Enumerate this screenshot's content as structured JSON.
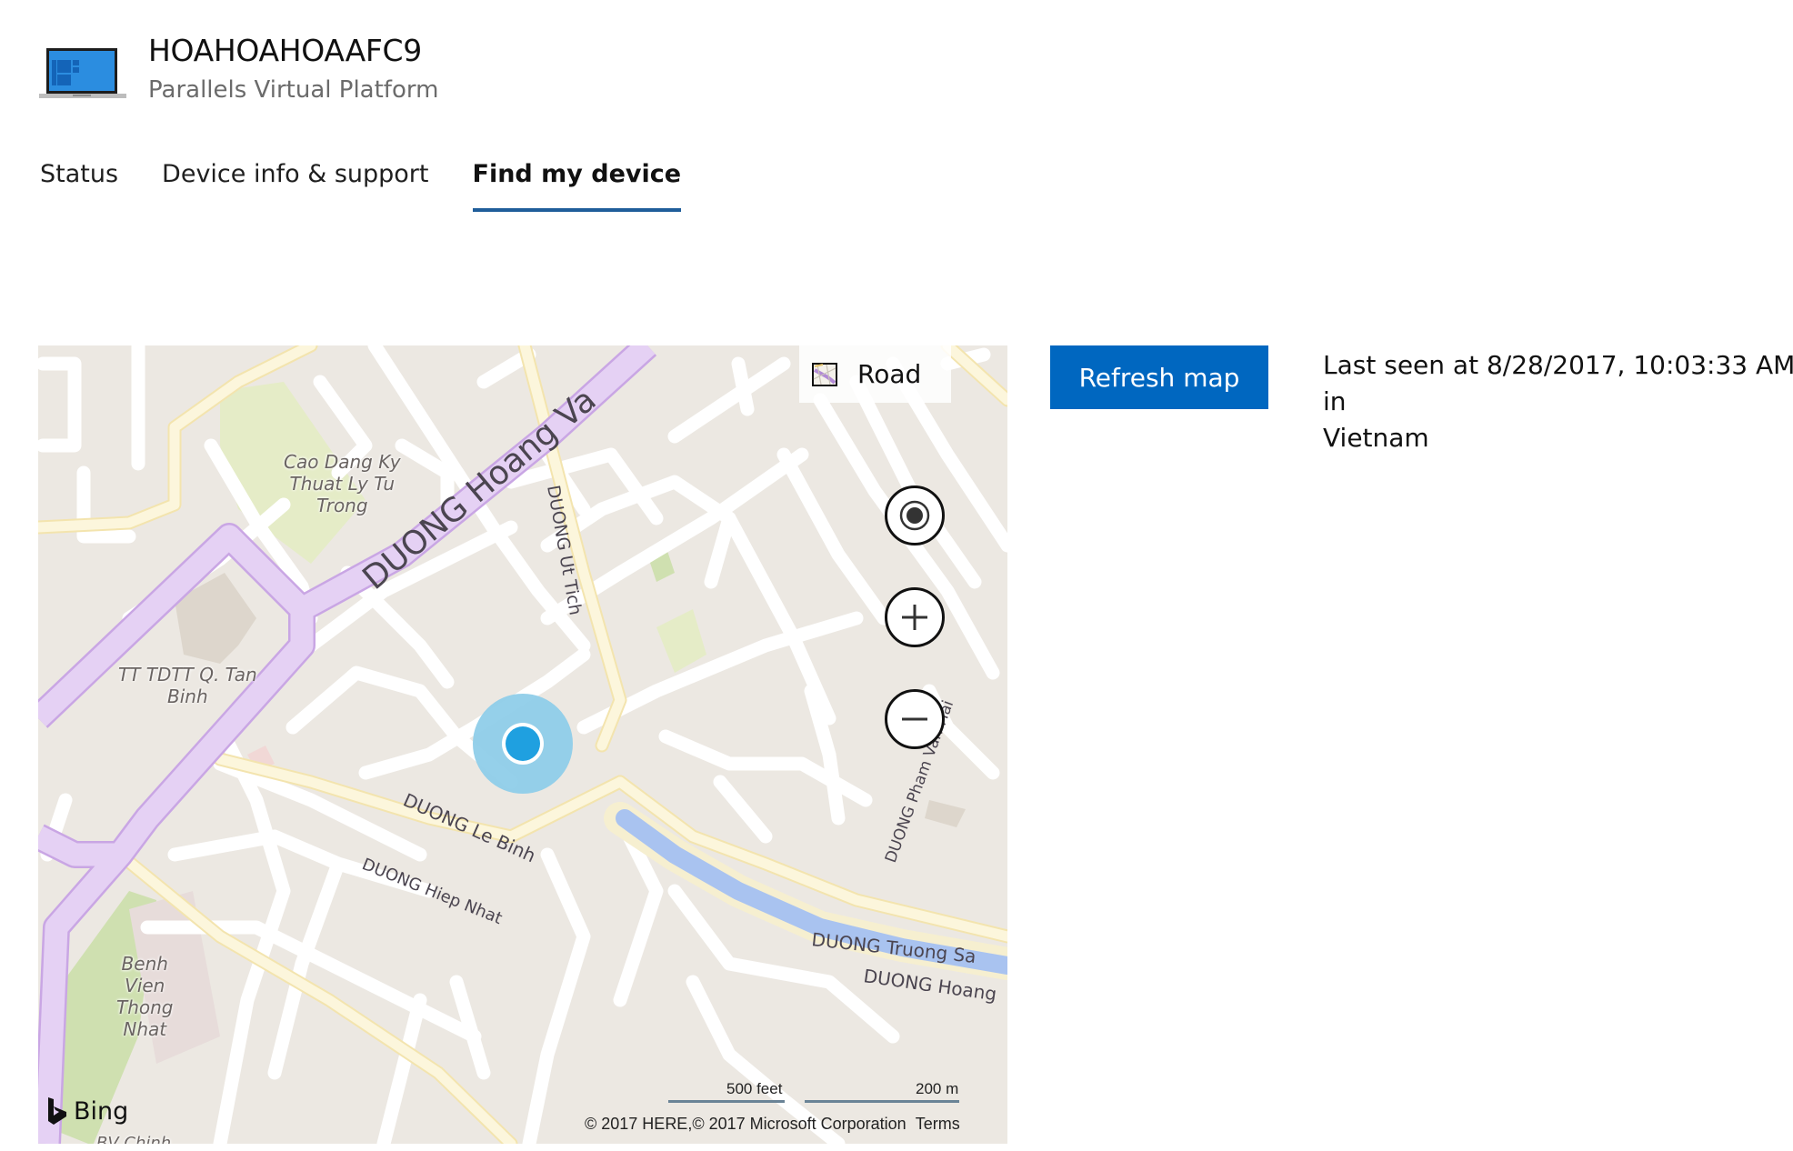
{
  "device": {
    "name": "HOAHOAHOAAFC9",
    "model": "Parallels Virtual Platform",
    "icon": "laptop-icon"
  },
  "tabs": [
    {
      "label": "Status",
      "active": false
    },
    {
      "label": "Device info & support",
      "active": false
    },
    {
      "label": "Find my device",
      "active": true
    }
  ],
  "actions": {
    "refresh_label": "Refresh map"
  },
  "last_seen": {
    "line1": "Last seen at 8/28/2017, 10:03:33 AM in",
    "line2": "Vietnam"
  },
  "map": {
    "style_label": "Road",
    "style_icon": "map-style-icon",
    "controls": [
      "locate-me-icon",
      "zoom-in-icon",
      "zoom-out-icon"
    ],
    "provider": "Bing",
    "scale_imperial": "500 feet",
    "scale_metric": "200 m",
    "copyright": "© 2017 HERE,© 2017 Microsoft Corporation",
    "terms_label": "Terms",
    "labels": {
      "poi_college": [
        "Cao Dang Ky",
        "Thuat Ly Tu",
        "Trong"
      ],
      "poi_sports": [
        "TT TDTT Q. Tan",
        "Binh"
      ],
      "poi_hospital": [
        "Benh",
        "Vien",
        "Thong",
        "Nhat"
      ],
      "poi_bottom": "BV Chinh",
      "road_hoang_van": "DUONG Hoang Va",
      "road_ut_tich": "DUONG Ut Tich",
      "road_le_binh": "DUONG Le Binh",
      "road_hiep_nhat": "DUONG Hiep Nhat",
      "road_truong_sa": "DUONG Truong Sa",
      "road_hoang": "DUONG Hoang",
      "road_pham_van_hai": "DUONG Pham Van Hai"
    },
    "colors": {
      "land": "#ece8e2",
      "street": "#ffffff",
      "arterial": "#fcf3c8",
      "highway": "#e5d1f4",
      "park": "#e5ecc7",
      "water": "#a9c3f0",
      "location_dot": "#1fa0e0",
      "location_halo": "#8fcde9"
    }
  },
  "colors": {
    "accent": "#0067c0",
    "tab_underline": "#1f5d9a"
  }
}
